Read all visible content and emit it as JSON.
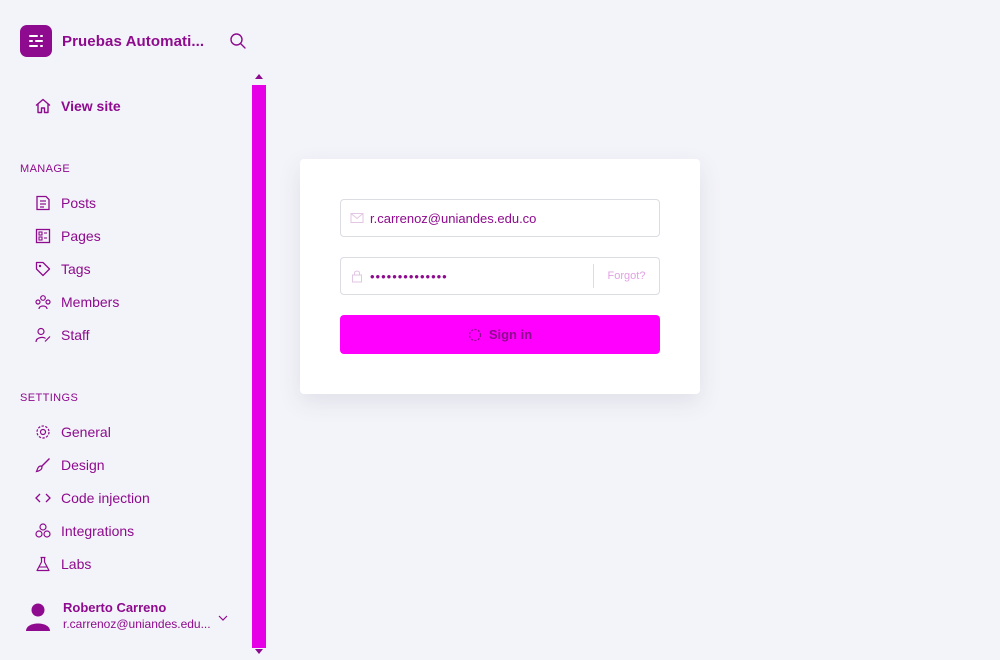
{
  "brand": {
    "name": "Pruebas Automati...",
    "logo_icon": "ghost-logo-icon",
    "search_icon": "search-icon"
  },
  "nav": {
    "view_site": "View site",
    "manage_label": "MANAGE",
    "manage_items": [
      {
        "label": "Posts",
        "icon": "posts-icon"
      },
      {
        "label": "Pages",
        "icon": "pages-icon"
      },
      {
        "label": "Tags",
        "icon": "tag-icon"
      },
      {
        "label": "Members",
        "icon": "members-icon"
      },
      {
        "label": "Staff",
        "icon": "staff-icon"
      }
    ],
    "settings_label": "SETTINGS",
    "settings_items": [
      {
        "label": "General",
        "icon": "gear-icon"
      },
      {
        "label": "Design",
        "icon": "brush-icon"
      },
      {
        "label": "Code injection",
        "icon": "code-icon"
      },
      {
        "label": "Integrations",
        "icon": "integrations-icon"
      },
      {
        "label": "Labs",
        "icon": "flask-icon"
      }
    ]
  },
  "user": {
    "name": "Roberto Carreno",
    "email": "r.carrenoz@uniandes.edu..."
  },
  "login": {
    "email_value": "r.carrenoz@uniandes.edu.co",
    "password_value": "••••••••••••••",
    "forgot_label": "Forgot?",
    "signin_label": "Sign in"
  },
  "colors": {
    "accent": "#ff00ff",
    "text": "#8e0a8e",
    "scrollbar": "#e600e6",
    "background": "#f3f4f9"
  }
}
